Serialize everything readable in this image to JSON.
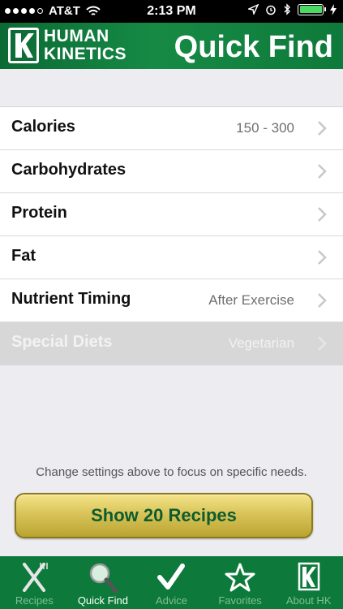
{
  "status_bar": {
    "carrier": "AT&T",
    "time": "2:13 PM",
    "battery_color": "#4cd964"
  },
  "header": {
    "logo_line1": "HUMAN",
    "logo_line2": "KINETICS",
    "title": "Quick Find",
    "brand_color": "#0d7a3c"
  },
  "filters": [
    {
      "label": "Calories",
      "value": "150 - 300",
      "enabled": true
    },
    {
      "label": "Carbohydrates",
      "value": "",
      "enabled": true
    },
    {
      "label": "Protein",
      "value": "",
      "enabled": true
    },
    {
      "label": "Fat",
      "value": "",
      "enabled": true
    },
    {
      "label": "Nutrient Timing",
      "value": "After Exercise",
      "enabled": true
    },
    {
      "label": "Special Diets",
      "value": "Vegetarian",
      "enabled": false
    }
  ],
  "hint": "Change settings above to focus on specific needs.",
  "cta_label": "Show 20 Recipes",
  "tabs": [
    {
      "label": "Recipes",
      "icon": "fork-knife-icon",
      "active": false
    },
    {
      "label": "Quick Find",
      "icon": "magnifier-icon",
      "active": true
    },
    {
      "label": "Advice",
      "icon": "checkmark-icon",
      "active": false
    },
    {
      "label": "Favorites",
      "icon": "star-icon",
      "active": false
    },
    {
      "label": "About HK",
      "icon": "hk-logo-icon",
      "active": false
    }
  ]
}
